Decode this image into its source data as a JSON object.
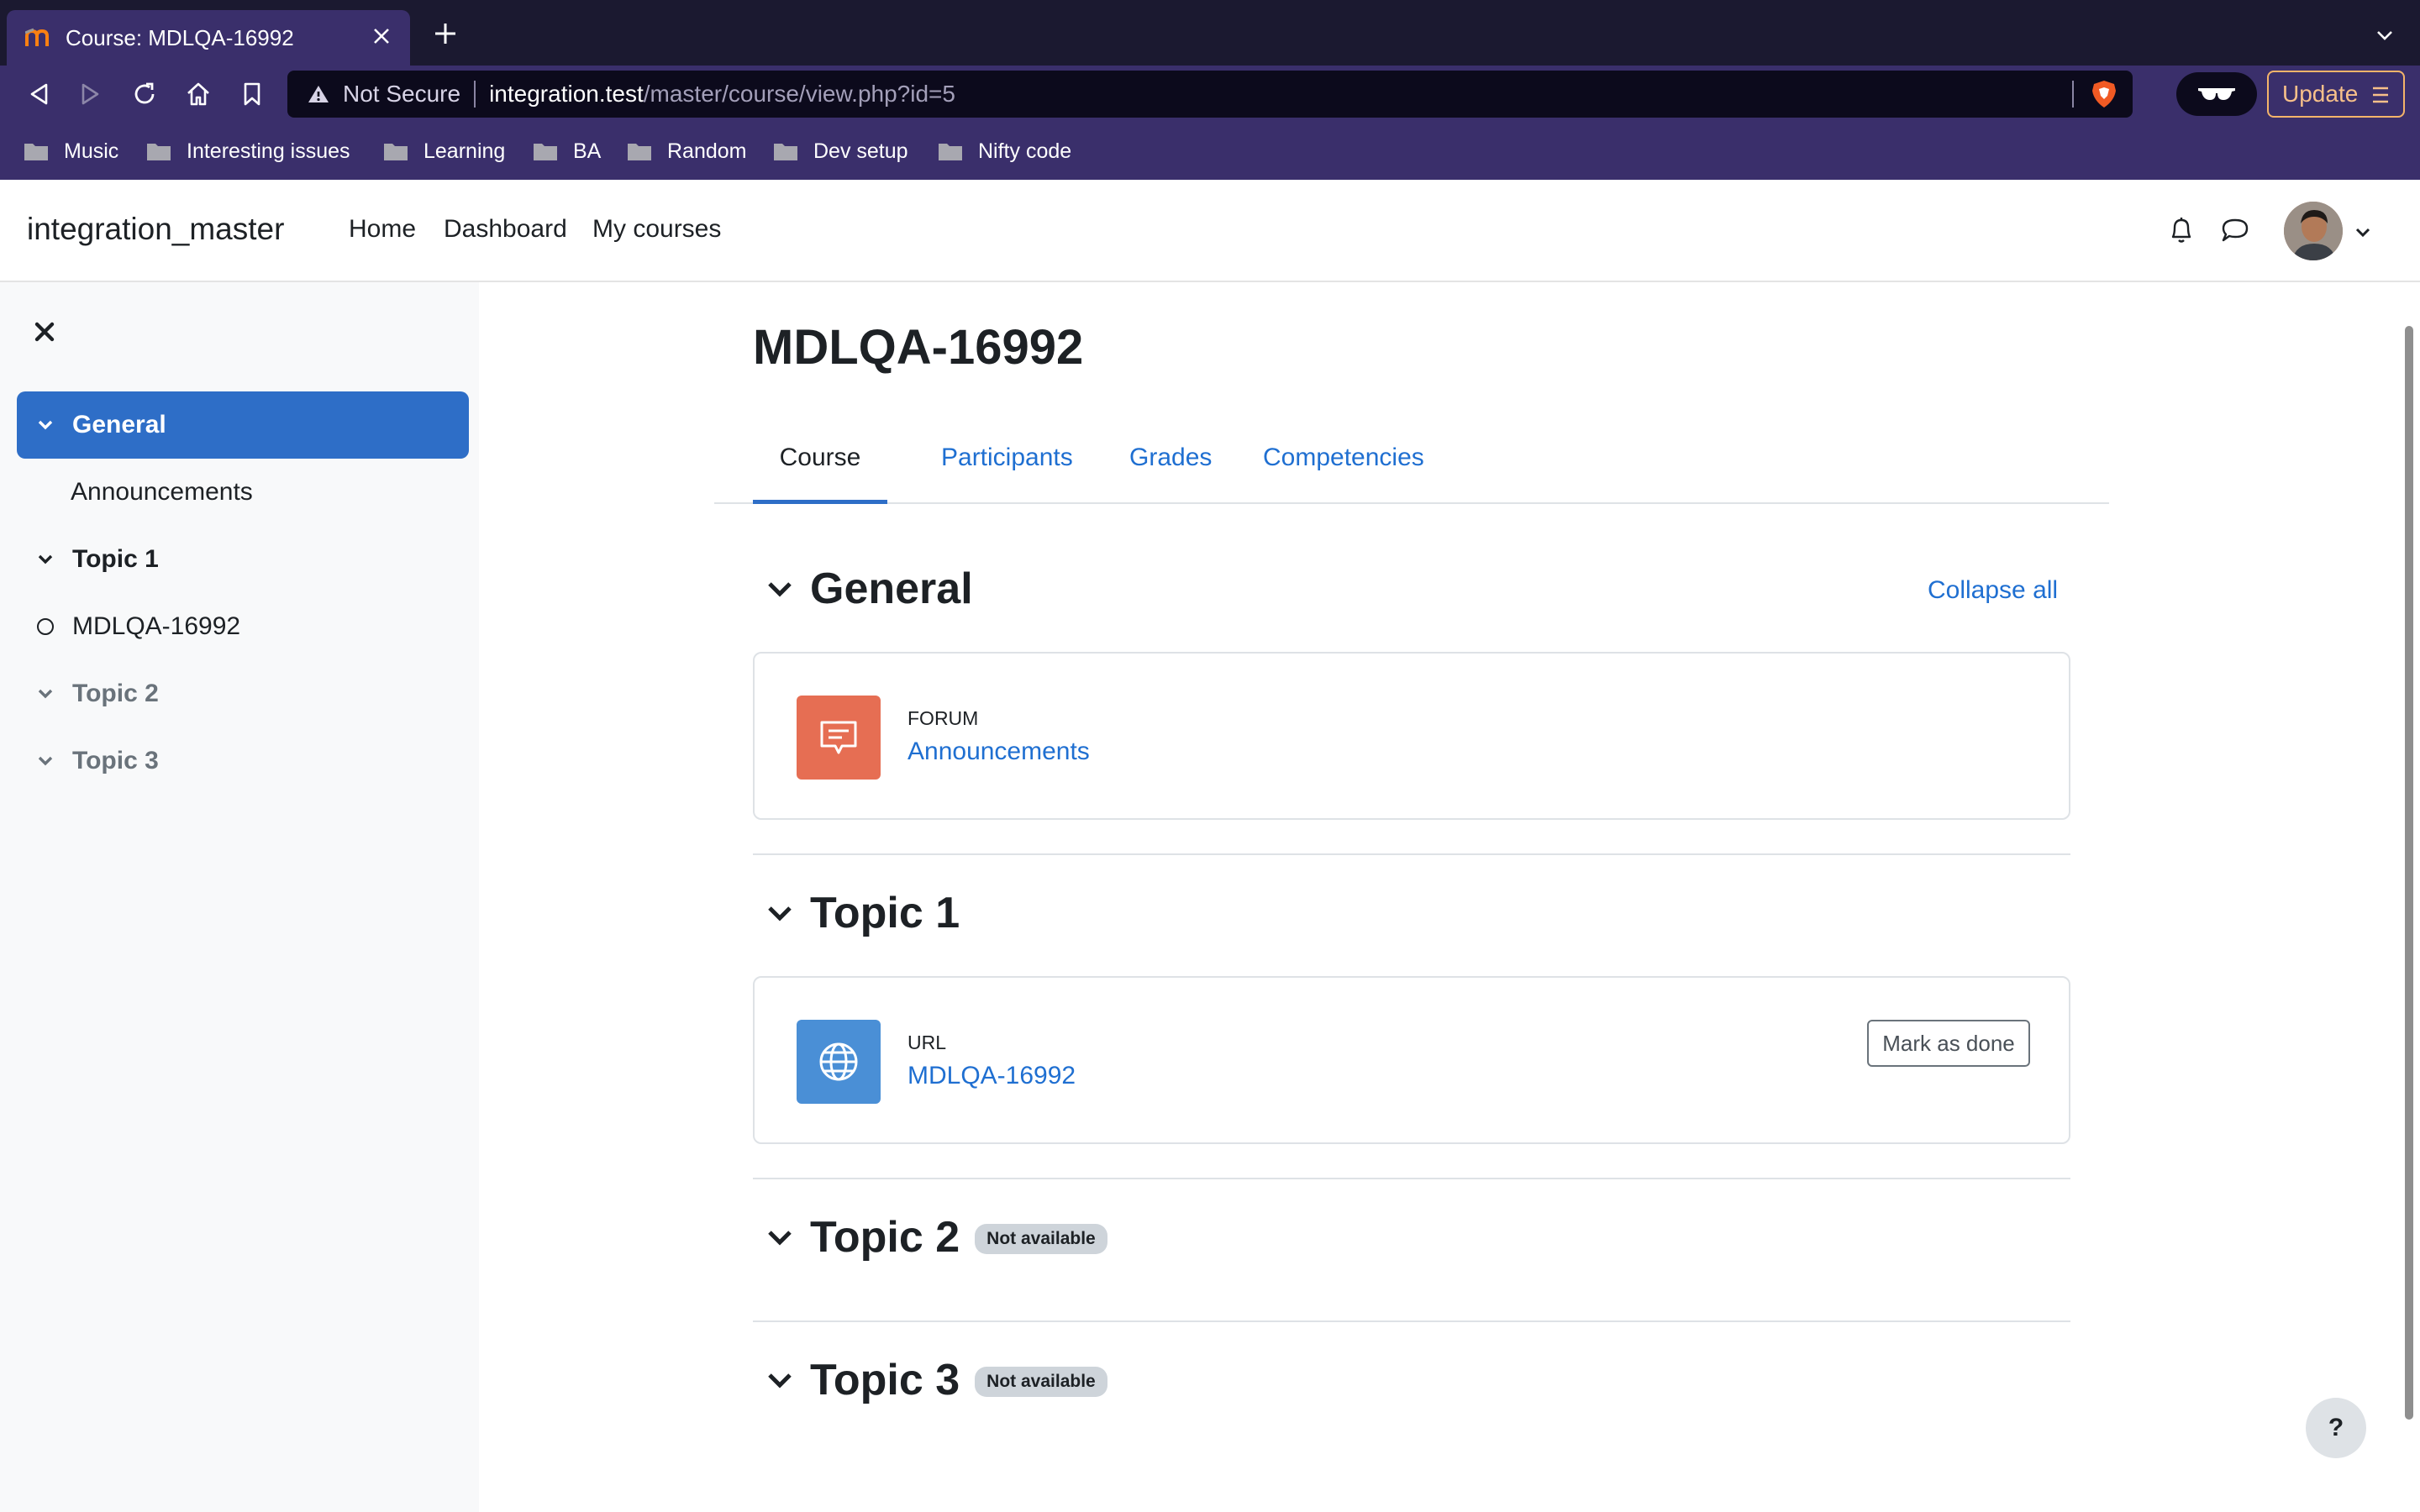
{
  "browser": {
    "tab": {
      "title": "Course: MDLQA-16992"
    },
    "address": {
      "security_label": "Not Secure",
      "host": "integration.test",
      "path": "/master/course/view.php?id=5"
    },
    "update_label": "Update",
    "bookmarks": [
      {
        "label": "Music"
      },
      {
        "label": "Interesting issues"
      },
      {
        "label": "Learning"
      },
      {
        "label": "BA"
      },
      {
        "label": "Random"
      },
      {
        "label": "Dev setup"
      },
      {
        "label": "Nifty code"
      }
    ]
  },
  "navbar": {
    "site_name": "integration_master",
    "links": [
      {
        "label": "Home"
      },
      {
        "label": "Dashboard"
      },
      {
        "label": "My courses"
      }
    ]
  },
  "course_index": {
    "items": [
      {
        "label": "General",
        "kind": "section",
        "state": "active"
      },
      {
        "label": "Announcements",
        "kind": "activity"
      },
      {
        "label": "Topic 1",
        "kind": "section"
      },
      {
        "label": "MDLQA-16992",
        "kind": "activity"
      },
      {
        "label": "Topic 2",
        "kind": "section",
        "state": "unavailable"
      },
      {
        "label": "Topic 3",
        "kind": "section",
        "state": "unavailable"
      }
    ]
  },
  "course": {
    "title": "MDLQA-16992",
    "tabs": [
      {
        "label": "Course",
        "active": true
      },
      {
        "label": "Participants"
      },
      {
        "label": "Grades"
      },
      {
        "label": "Competencies"
      }
    ],
    "collapse_all_label": "Collapse all",
    "sections": [
      {
        "title": "General",
        "activities": [
          {
            "type": "FORUM",
            "name": "Announcements",
            "icon": "forum-icon",
            "color": "#e66e53"
          }
        ]
      },
      {
        "title": "Topic 1",
        "activities": [
          {
            "type": "URL",
            "name": "MDLQA-16992",
            "icon": "globe-icon",
            "color": "#4a8fd6",
            "completion_label": "Mark as done"
          }
        ]
      },
      {
        "title": "Topic 2",
        "badge": "Not available"
      },
      {
        "title": "Topic 3",
        "badge": "Not available"
      }
    ]
  },
  "help_label": "?",
  "colors": {
    "primary": "#2e6ec7",
    "link": "#1f6fd1",
    "browser_frame": "#3a2f6b",
    "forum": "#e66e53",
    "url": "#4a8fd6"
  }
}
